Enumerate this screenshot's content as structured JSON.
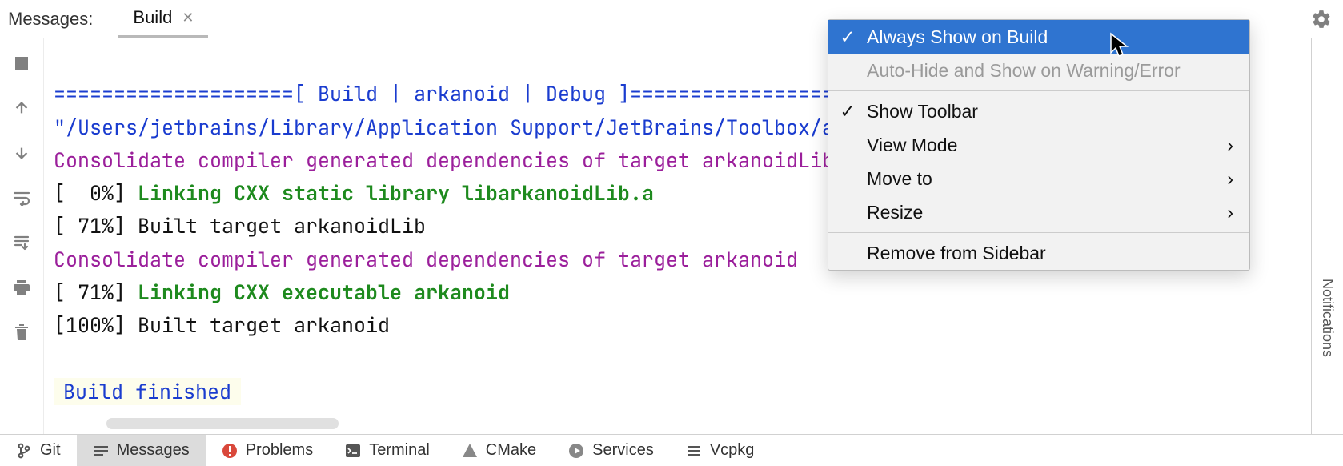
{
  "header": {
    "title": "Messages:",
    "tab": "Build"
  },
  "console": {
    "l1_blue": "====================[ Build | arkanoid | Debug ]=================================",
    "l2_blue": "\"/Users/jetbrains/Library/Application Support/JetBrains/Toolbox/a",
    "l3_purple": "Consolidate compiler generated dependencies of target arkanoidLib",
    "l4_prefix": "[  0%] ",
    "l4_green": "Linking CXX static library libarkanoidLib.a",
    "l5_black": "[ 71%] Built target arkanoidLib",
    "l6_purple": "Consolidate compiler generated dependencies of target arkanoid",
    "l7_prefix": "[ 71%] ",
    "l7_green": "Linking CXX executable arkanoid",
    "l8_black": "[100%] Built target arkanoid",
    "finished": "Build finished"
  },
  "right_sidebar": {
    "notifications": "Notifications"
  },
  "bottom_bar": {
    "git": "Git",
    "messages": "Messages",
    "problems": "Problems",
    "terminal": "Terminal",
    "cmake": "CMake",
    "services": "Services",
    "vcpkg": "Vcpkg"
  },
  "context_menu": {
    "always_show": "Always Show on Build",
    "auto_hide": "Auto-Hide and Show on Warning/Error",
    "show_toolbar": "Show Toolbar",
    "view_mode": "View Mode",
    "move_to": "Move to",
    "resize": "Resize",
    "remove": "Remove from Sidebar"
  }
}
